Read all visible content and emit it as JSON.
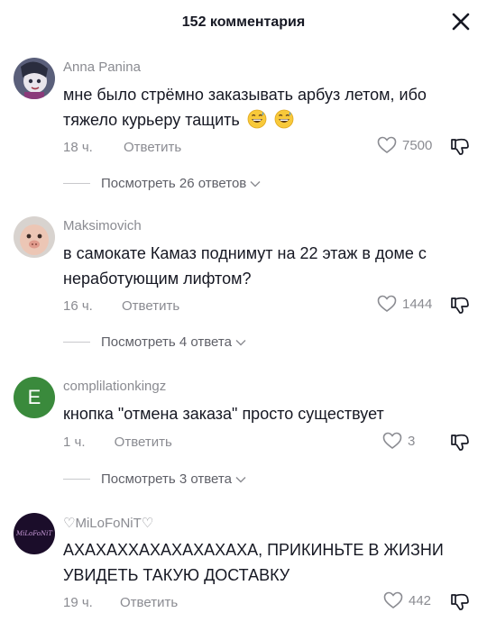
{
  "header": {
    "title": "152 комментария"
  },
  "comments": [
    {
      "author": "Anna Panina",
      "text": "мне было стрёмно заказывать арбуз летом, ибо тяжело курьеру тащить",
      "emoji": [
        "grinning-sweat-emoji",
        "grinning-sweat-emoji"
      ],
      "time": "18 ч.",
      "reply_label": "Ответить",
      "likes": "7500",
      "view_replies": "Посмотреть 26 ответов"
    },
    {
      "author": "Maksimovich",
      "text": "в самокате Камаз поднимут на 22 этаж в доме с неработующим лифтом?",
      "time": "16 ч.",
      "reply_label": "Ответить",
      "likes": "1444",
      "view_replies": "Посмотреть 4 ответа"
    },
    {
      "author": "complilationkingz",
      "avatar_letter": "E",
      "text": "кнопка \"отмена заказа\" просто существует",
      "time": "1 ч.",
      "reply_label": "Ответить",
      "likes": "3",
      "view_replies": "Посмотреть 3 ответа"
    },
    {
      "author": "♡MiLoFoNiT♡",
      "avatar_text": "MiLoFoNiT",
      "text": "АХАХАХХАХАХАХАХАХА, ПРИКИНЬТЕ В ЖИЗНИ УВИДЕТЬ ТАКУЮ ДОСТАВКУ",
      "time": "19 ч.",
      "reply_label": "Ответить",
      "likes": "442"
    }
  ],
  "colors": {
    "text": "#161823",
    "muted": "#8a8b91",
    "avatar_green": "#3a8a3c"
  }
}
